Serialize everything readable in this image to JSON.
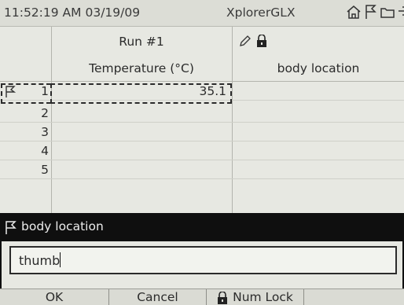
{
  "status": {
    "time": "11:52:19 AM",
    "date": "03/19/09",
    "app": "XplorerGLX"
  },
  "status_icons": [
    "home-icon",
    "flag-icon",
    "folder-icon",
    "power-icon"
  ],
  "table": {
    "run_label": "Run #1",
    "measurement_label": "Temperature  (°C)",
    "text_column_label": "body location",
    "rows": [
      {
        "num": "1",
        "value": "35.1"
      },
      {
        "num": "2",
        "value": ""
      },
      {
        "num": "3",
        "value": ""
      },
      {
        "num": "4",
        "value": ""
      },
      {
        "num": "5",
        "value": ""
      }
    ]
  },
  "dialog": {
    "title": "body location",
    "input_value": "thumb"
  },
  "softkeys": {
    "ok": "OK",
    "cancel": "Cancel",
    "numlock": "Num Lock"
  },
  "colors": {
    "background": "#e9eae4",
    "dialog_bar": "#0f0f0f",
    "text": "#2b2b2b"
  }
}
